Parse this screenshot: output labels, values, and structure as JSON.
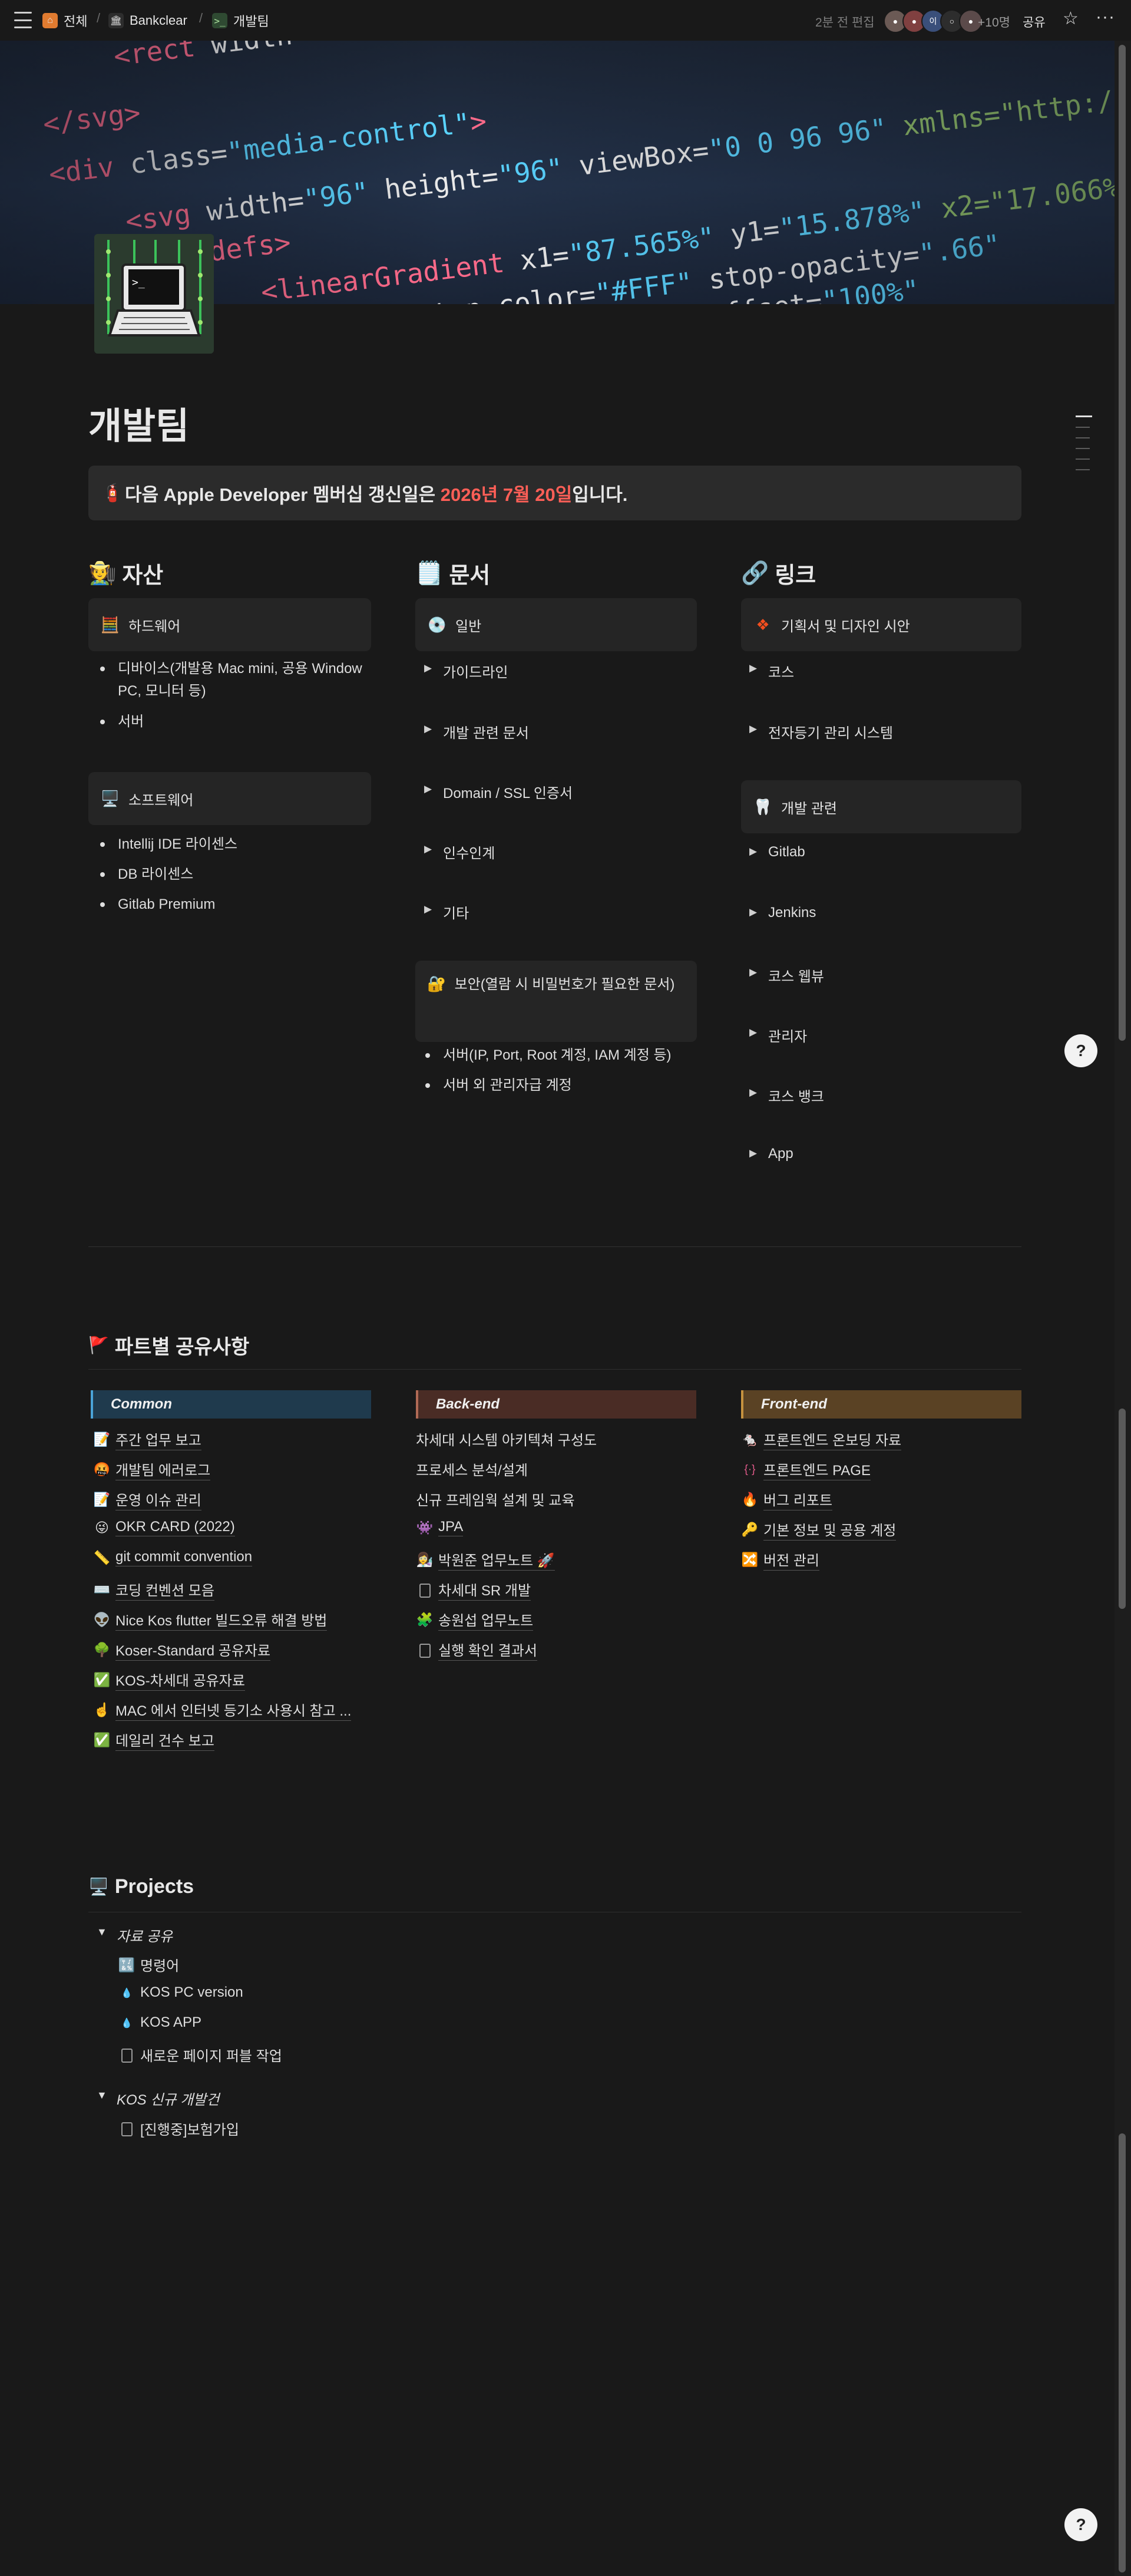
{
  "topbar": {
    "breadcrumb": [
      {
        "label": "전체",
        "icon": "house-icon"
      },
      {
        "label": "Bankclear",
        "icon": "bank-icon"
      },
      {
        "label": "개발팀",
        "icon": "terminal-icon"
      }
    ],
    "edited": "2분 전 편집",
    "avatar_initial": "이",
    "more_count": "+10명",
    "share": "공유"
  },
  "page": {
    "title": "개발팀",
    "callout": {
      "icon": "🧯",
      "prefix": "다음 Apple Developer 멤버십 갱신일은 ",
      "date": "2026년 7월 20일",
      "suffix": "입니다."
    }
  },
  "assets": {
    "title": "자산",
    "icon": "🧑‍🌾",
    "hardware": {
      "label": "하드웨어",
      "icon": "🧮",
      "items": [
        "디바이스(개발용 Mac mini, 공용 Window PC, 모니터 등)",
        "서버"
      ]
    },
    "software": {
      "label": "소프트웨어",
      "icon": "🖥️",
      "items": [
        "Intellij IDE 라이센스",
        "DB 라이센스",
        "Gitlab Premium"
      ]
    }
  },
  "docs": {
    "title": "문서",
    "icon": "🗒️",
    "general": {
      "label": "일반",
      "icon": "💿",
      "toggles": [
        "가이드라인",
        "개발 관련 문서",
        "Domain / SSL 인증서",
        "인수인계",
        "기타"
      ]
    },
    "security": {
      "label": "보안(열람 시 비밀번호가 필요한 문서)",
      "icon": "🔐",
      "items": [
        "서버(IP, Port, Root 계정, IAM 계정 등)",
        "서버 외 관리자급 계정"
      ]
    }
  },
  "links": {
    "title": "링크",
    "icon": "🔗",
    "planning": {
      "label": "기획서 및 디자인 시안",
      "icon": "figma-icon",
      "toggles": [
        "코스",
        "전자등기 관리 시스템"
      ]
    },
    "dev": {
      "label": "개발 관련",
      "icon": "🦷",
      "toggles": [
        "Gitlab",
        "Jenkins",
        "코스 웹뷰",
        "관리자",
        "코스 뱅크",
        "App"
      ]
    }
  },
  "parts": {
    "title": "파트별 공유사항",
    "icon": "🚩",
    "common": {
      "header": "Common",
      "color": "#1f3a4d",
      "items": [
        {
          "icon": "📝",
          "label": "주간 업무 보고"
        },
        {
          "icon": "🤬",
          "label": "개발팀 에러로그"
        },
        {
          "icon": "📝",
          "label": "운영 이슈 관리"
        },
        {
          "icon": "😜",
          "label": "OKR CARD (2022)"
        },
        {
          "icon": "📏",
          "label": "git commit convention"
        },
        {
          "icon": "⌨️",
          "label": "코딩 컨벤션 모음"
        },
        {
          "icon": "👽",
          "label": "Nice Kos flutter 빌드오류 해결 방법"
        },
        {
          "icon": "🌳",
          "label": "Koser-Standard 공유자료"
        },
        {
          "icon": "✅",
          "label": "KOS-차세대 공유자료"
        },
        {
          "icon": "☝️",
          "label": "MAC 에서 인터넷 등기소 사용시 참고 ..."
        },
        {
          "icon": "✅",
          "label": "데일리 건수 보고"
        }
      ]
    },
    "backend": {
      "header": "Back-end",
      "color": "#4a2c25",
      "items": [
        {
          "icon": "",
          "label": "차세대 시스템 아키텍쳐 구성도"
        },
        {
          "icon": "",
          "label": "프로세스 분석/설계"
        },
        {
          "icon": "",
          "label": "신규 프레임웍 설계 및 교육"
        },
        {
          "icon": "👾",
          "label": "JPA"
        },
        {
          "icon": "👩‍🔬",
          "label": "박원준 업무노트 🚀"
        },
        {
          "icon": "doc",
          "label": "차세대 SR 개발"
        },
        {
          "icon": "🧩",
          "label": "송원섭 업무노트"
        },
        {
          "icon": "doc",
          "label": "실행 확인 결과서"
        }
      ]
    },
    "frontend": {
      "header": "Front-end",
      "color": "#5a4224",
      "items": [
        {
          "icon": "🐁",
          "label": "프론트엔드 온보딩 자료"
        },
        {
          "icon": "{·}",
          "label": "프론트엔드 PAGE"
        },
        {
          "icon": "🔥",
          "label": "버그 리포트"
        },
        {
          "icon": "🔑",
          "label": "기본 정보 및 공용 계정"
        },
        {
          "icon": "🔀",
          "label": "버전 관리"
        }
      ]
    }
  },
  "projects": {
    "title": "Projects",
    "icon": "🖥️",
    "groups": [
      {
        "label": "자료 공유",
        "items": [
          {
            "icon": "🔣",
            "label": "명령어"
          },
          {
            "icon": "💧",
            "label": "KOS PC version"
          },
          {
            "icon": "💧",
            "label": "KOS APP"
          },
          {
            "icon": "doc",
            "label": "새로운 페이지 퍼블 작업"
          }
        ]
      },
      {
        "label": "KOS 신규 개발건",
        "items": [
          {
            "icon": "doc",
            "label": "[진행중]보험가입"
          }
        ]
      }
    ]
  },
  "colors": {
    "background": "#191919",
    "accent_red": "#ff5f57",
    "card": "#252525"
  }
}
